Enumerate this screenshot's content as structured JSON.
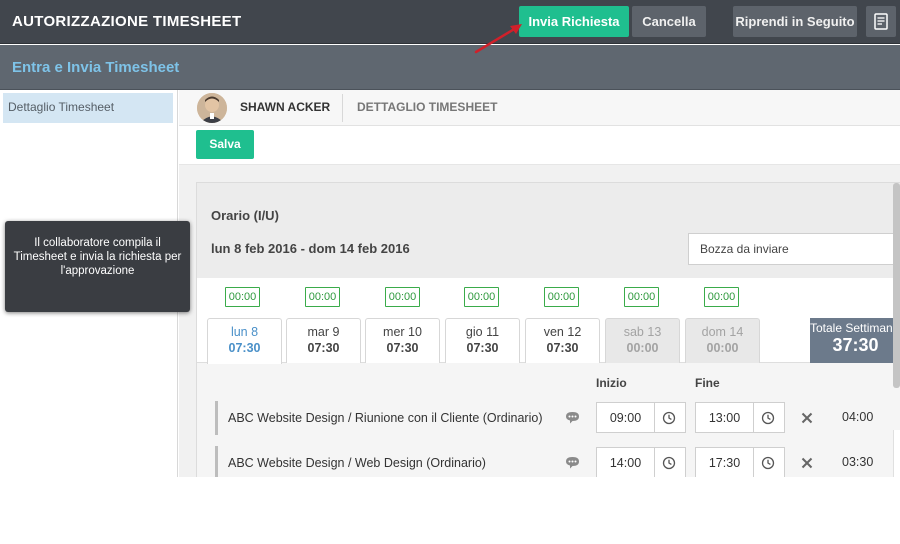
{
  "header": {
    "app_title": "AUTORIZZAZIONE TIMESHEET",
    "submit_label": "Invia Richiesta",
    "cancel_label": "Cancella",
    "later_label": "Riprendi in Seguito",
    "notes_icon": "notes-icon"
  },
  "subheader": {
    "title": "Entra e Invia Timesheet"
  },
  "sidebar": {
    "items": [
      {
        "label": "Dettaglio Timesheet"
      }
    ]
  },
  "tooltip": {
    "text": "Il collaboratore compila il Timesheet e invia la richiesta per l'approvazione"
  },
  "main": {
    "employee_name": "SHAWN ACKER",
    "breadcrumb": "DETTAGLIO TIMESHEET",
    "save_label": "Salva",
    "section_title": "Orario (I/U)",
    "date_range": "lun 8 feb 2016 - dom 14 feb 2016",
    "status": "Bozza da inviare",
    "chips": [
      "00:00",
      "00:00",
      "00:00",
      "00:00",
      "00:00",
      "00:00",
      "00:00"
    ],
    "days": [
      {
        "name": "lun 8",
        "hours": "07:30",
        "state": "active"
      },
      {
        "name": "mar 9",
        "hours": "07:30",
        "state": "normal"
      },
      {
        "name": "mer 10",
        "hours": "07:30",
        "state": "normal"
      },
      {
        "name": "gio 11",
        "hours": "07:30",
        "state": "normal"
      },
      {
        "name": "ven 12",
        "hours": "07:30",
        "state": "normal"
      },
      {
        "name": "sab 13",
        "hours": "00:00",
        "state": "weekend"
      },
      {
        "name": "dom 14",
        "hours": "00:00",
        "state": "weekend"
      }
    ],
    "weekly_total": {
      "label": "Totale Settimanale",
      "value": "37:30"
    },
    "columns": {
      "start": "Inizio",
      "end": "Fine"
    },
    "entries": [
      {
        "label": "ABC Website Design / Riunione con il Cliente (Ordinario)",
        "start": "09:00",
        "end": "13:00",
        "duration": "04:00"
      },
      {
        "label": "ABC Website Design / Web Design (Ordinario)",
        "start": "14:00",
        "end": "17:30",
        "duration": "03:30"
      }
    ]
  },
  "colors": {
    "accent_green": "#1fbf8f",
    "link_blue": "#7ec3e8",
    "annotation_red": "#d0202a",
    "total_bg": "#6c7a8b"
  }
}
